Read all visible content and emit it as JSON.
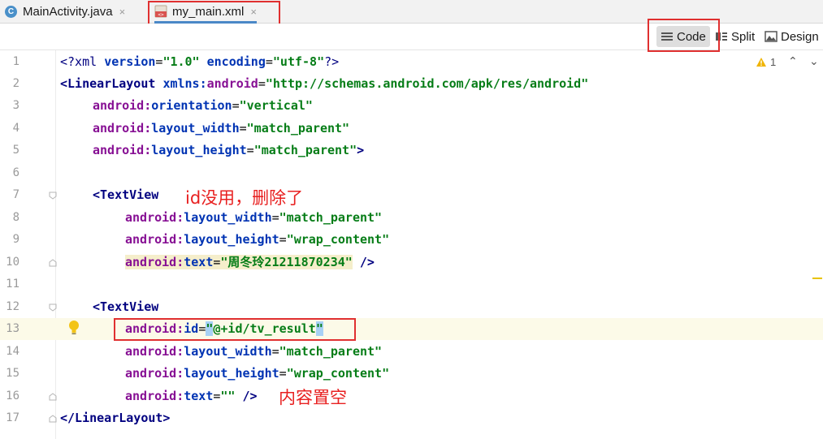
{
  "tabs": [
    {
      "label": "MainActivity.java",
      "icon": "java-class-icon",
      "close": "×"
    },
    {
      "label": "my_main.xml",
      "icon": "xml-file-icon",
      "close": "×"
    }
  ],
  "view_modes": {
    "code": "Code",
    "split": "Split",
    "design": "Design"
  },
  "inspections": {
    "warning_count": "1"
  },
  "line_numbers": [
    "1",
    "2",
    "3",
    "4",
    "5",
    "6",
    "7",
    "8",
    "9",
    "10",
    "11",
    "12",
    "13",
    "14",
    "15",
    "16",
    "17"
  ],
  "code": {
    "l1_a": "<?xml ",
    "l1_b": "version",
    "l1_c": "=",
    "l1_d": "\"1.0\"",
    "l1_e": " encoding",
    "l1_f": "=",
    "l1_g": "\"utf-8\"",
    "l1_h": "?>",
    "l2_a": "<LinearLayout ",
    "l2_b": "xmlns:",
    "l2_c": "android",
    "l2_d": "=",
    "l2_e": "\"http://schemas.android.com/apk/res/android\"",
    "l3_a": "android:",
    "l3_b": "orientation",
    "l3_c": "=",
    "l3_d": "\"vertical\"",
    "l4_a": "android:",
    "l4_b": "layout_width",
    "l4_c": "=",
    "l4_d": "\"match_parent\"",
    "l5_a": "android:",
    "l5_b": "layout_height",
    "l5_c": "=",
    "l5_d": "\"match_parent\"",
    "l5_e": ">",
    "l7_a": "<TextView",
    "l8_a": "android:",
    "l8_b": "layout_width",
    "l8_c": "=",
    "l8_d": "\"match_parent\"",
    "l9_a": "android:",
    "l9_b": "layout_height",
    "l9_c": "=",
    "l9_d": "\"wrap_content\"",
    "l10_a": "android:",
    "l10_b": "text",
    "l10_c": "=",
    "l10_d": "\"周冬玲21211870234\"",
    "l10_e": " />",
    "l12_a": "<TextView",
    "l13_a": "android:",
    "l13_b": "id",
    "l13_c": "=",
    "l13_d": "\"",
    "l13_e": "@+id/tv_result",
    "l13_f": "\"",
    "l14_a": "android:",
    "l14_b": "layout_width",
    "l14_c": "=",
    "l14_d": "\"match_parent\"",
    "l15_a": "android:",
    "l15_b": "layout_height",
    "l15_c": "=",
    "l15_d": "\"wrap_content\"",
    "l16_a": "android:",
    "l16_b": "text",
    "l16_c": "=",
    "l16_d": "\"\"",
    "l16_e": " />",
    "l17_a": "</LinearLayout>"
  },
  "annotations": {
    "id_unused": "id没用，删除了",
    "content_empty": "内容置空"
  },
  "colors": {
    "annotation": "#e82020",
    "active_tab_underline": "#4a88c7"
  }
}
